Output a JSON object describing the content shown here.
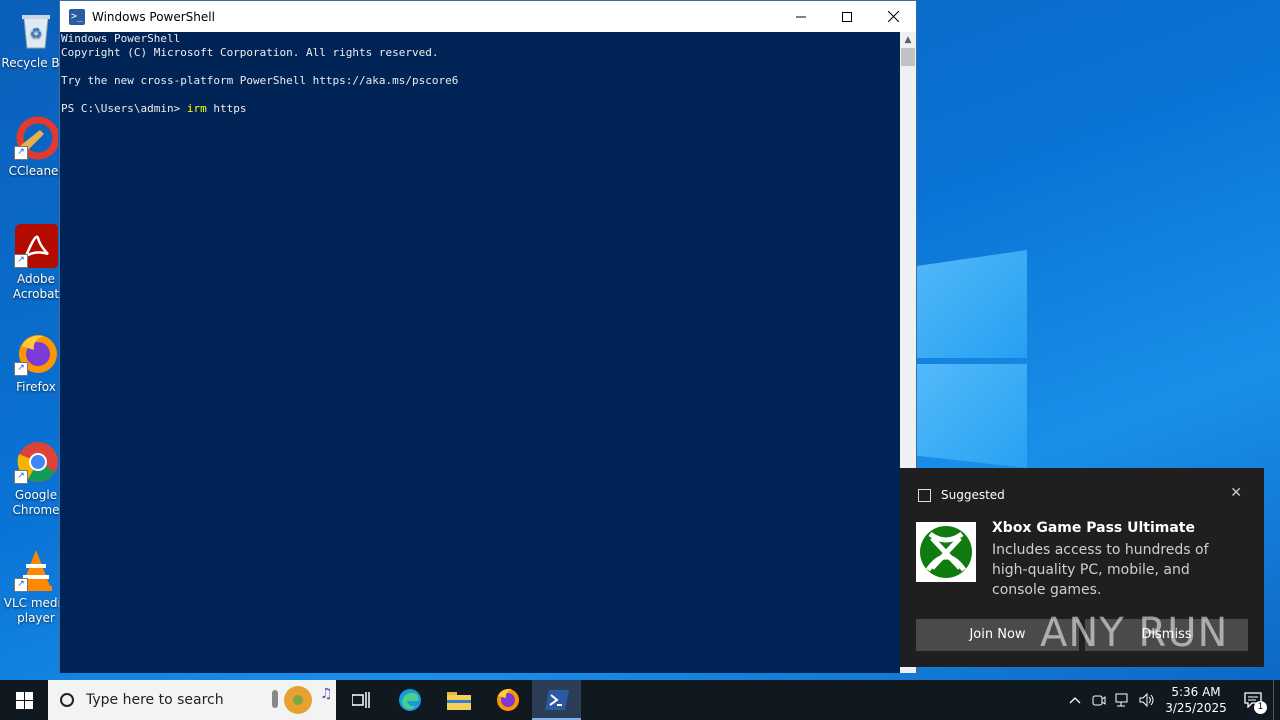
{
  "desktop": {
    "icons": [
      {
        "label": "Recycle Bin"
      },
      {
        "label": "CCleaner"
      },
      {
        "label": "Adobe Acrobat"
      },
      {
        "label": "Firefox"
      },
      {
        "label": "Google Chrome"
      },
      {
        "label": "VLC media player"
      }
    ]
  },
  "window": {
    "title": "Windows PowerShell",
    "console_lines": [
      "Windows PowerShell",
      "Copyright (C) Microsoft Corporation. All rights reserved.",
      "",
      "Try the new cross-platform PowerShell https://aka.ms/pscore6",
      ""
    ],
    "prompt": "PS C:\\Users\\admin> ",
    "command": "irm",
    "argument": " https"
  },
  "toast": {
    "header": "Suggested",
    "title": "Xbox Game Pass Ultimate",
    "description": "Includes access to hundreds of high-quality PC, mobile, and console games.",
    "join_label": "Join Now",
    "dismiss_label": "Dismiss"
  },
  "watermark": "ANY RUN",
  "taskbar": {
    "search_placeholder": "Type here to search",
    "time": "5:36 AM",
    "date": "3/25/2025",
    "notification_count": "1"
  },
  "colors": {
    "console_bg": "#012456",
    "console_text": "#eeedf0",
    "command_highlight": "#ffff00",
    "taskbar_bg": "#101820",
    "xbox_green": "#107c10"
  }
}
